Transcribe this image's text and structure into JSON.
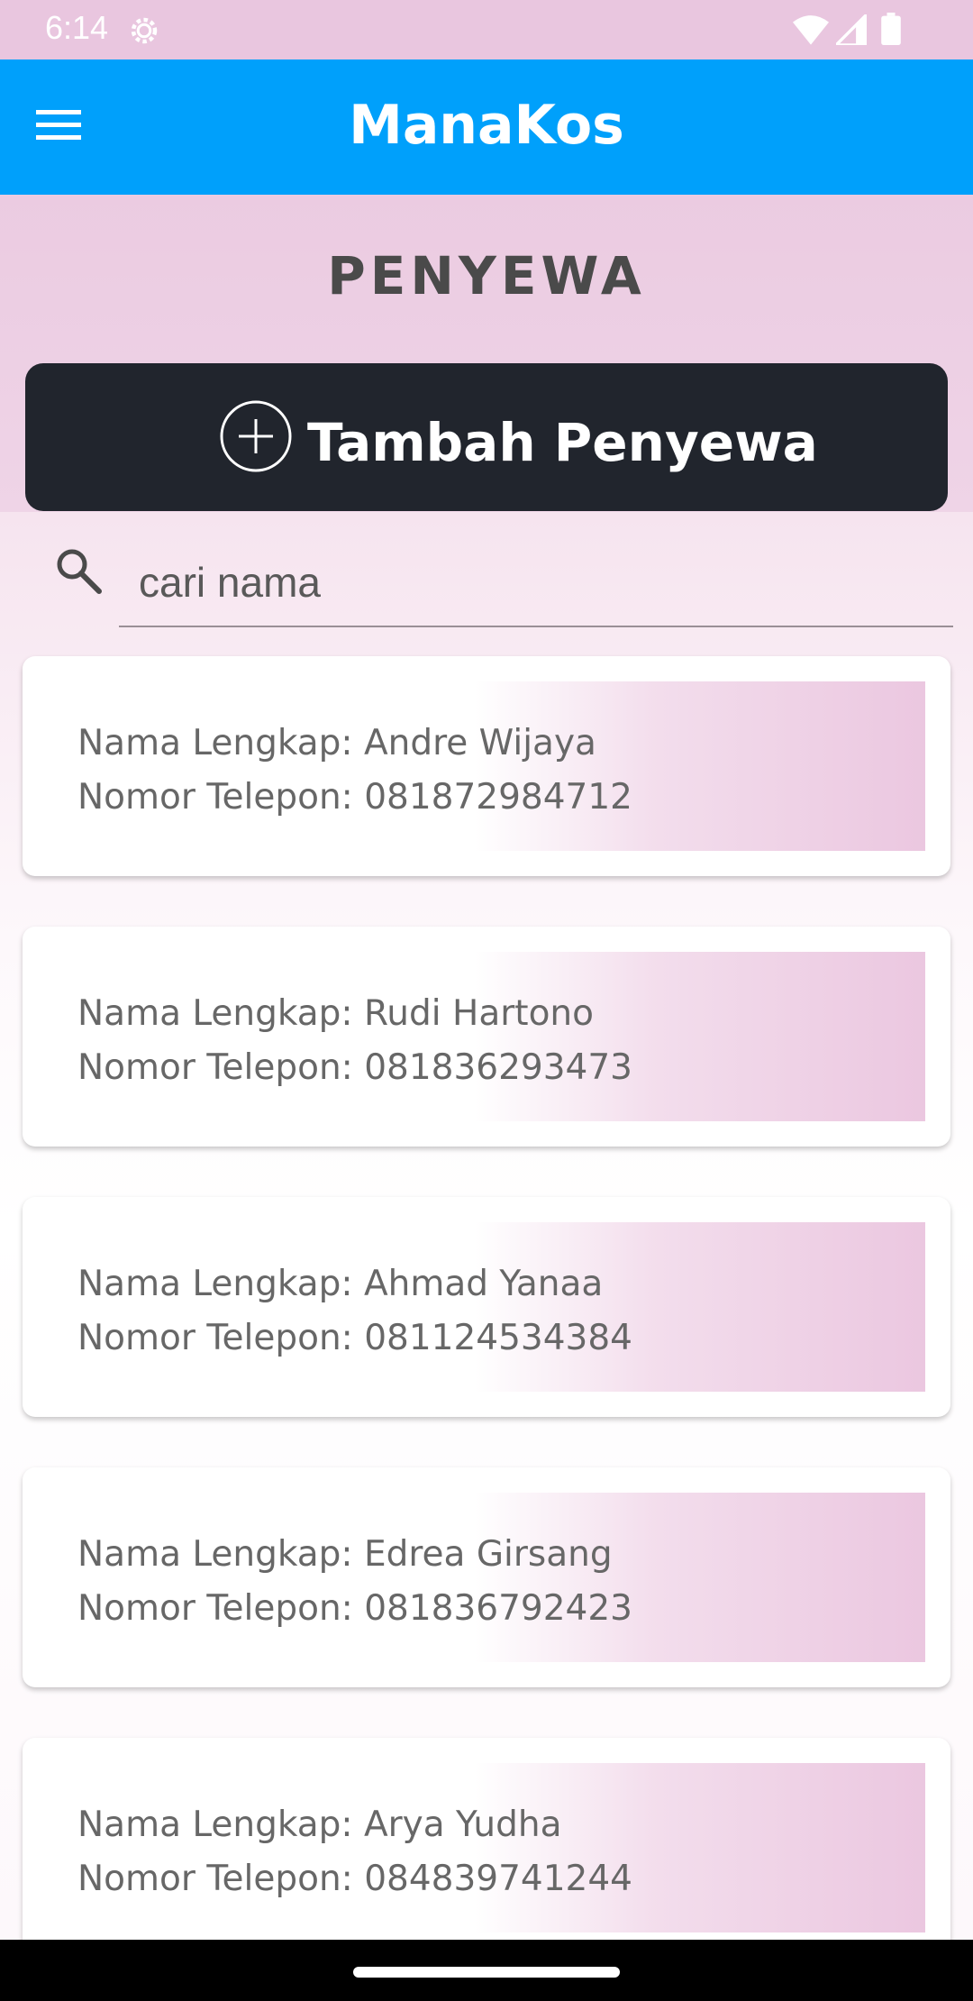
{
  "status_bar": {
    "time": "6:14"
  },
  "app_bar": {
    "title": "ManaKos",
    "menu_icon": "hamburger-menu-icon"
  },
  "page": {
    "title": "PENYEWA"
  },
  "add_button": {
    "label": "Tambah Penyewa",
    "icon": "plus-circle-icon"
  },
  "search": {
    "placeholder": "cari nama",
    "icon": "search-icon"
  },
  "tenants": [
    {
      "name_line": "Nama Lengkap: Andre Wijaya",
      "phone_line": "Nomor Telepon: 081872984712"
    },
    {
      "name_line": "Nama Lengkap: Rudi Hartono",
      "phone_line": "Nomor Telepon: 081836293473"
    },
    {
      "name_line": "Nama Lengkap: Ahmad Yanaa",
      "phone_line": "Nomor Telepon: 081124534384"
    },
    {
      "name_line": "Nama Lengkap: Edrea Girsang",
      "phone_line": "Nomor Telepon: 081836792423"
    },
    {
      "name_line": "Nama Lengkap: Arya Yudha",
      "phone_line": "Nomor Telepon: 084839741244"
    }
  ],
  "colors": {
    "app_bar": "#00a0fb",
    "button": "#21252d",
    "accent_pink": "#ebc7e0"
  }
}
